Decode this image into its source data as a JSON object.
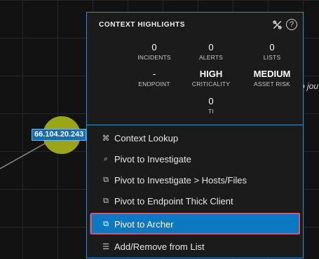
{
  "graph": {
    "node_label": "66.104.20.243",
    "edge_text": "o jou",
    "colors": {
      "node": "#9aa617",
      "label_bg": "#0f6fb5"
    }
  },
  "popup": {
    "title": "CONTEXT HIGHLIGHTS",
    "help_glyph": "?",
    "icons": [
      "tools-icon",
      "help-icon"
    ],
    "stats": [
      {
        "value": "0",
        "label": "INCIDENTS"
      },
      {
        "value": "0",
        "label": "ALERTS"
      },
      {
        "value": "0",
        "label": "LISTS"
      },
      {
        "value": "-",
        "label": "ENDPOINT"
      },
      {
        "value": "HIGH",
        "label": "CRITICALITY"
      },
      {
        "value": "MEDIUM",
        "label": "ASSET RISK"
      },
      {
        "value": "0",
        "label": "TI"
      }
    ],
    "menu": [
      {
        "label": "Context Lookup",
        "icon": "lookup-icon",
        "glyph": "⌘"
      },
      {
        "label": "Pivot to Investigate",
        "icon": "search-icon",
        "glyph": "⌕"
      },
      {
        "label": "Pivot to Investigate > Hosts/Files",
        "icon": "external-link-icon",
        "glyph": "⧉"
      },
      {
        "label": "Pivot to Endpoint Thick Client",
        "icon": "external-link-icon",
        "glyph": "⧉"
      },
      {
        "label": "Pivot to Archer",
        "icon": "external-link-icon",
        "glyph": "⧉",
        "active": true
      },
      {
        "label": "Add/Remove from List",
        "icon": "list-icon",
        "glyph": "☰"
      }
    ],
    "colors": {
      "accent": "#0a79c2",
      "border": "#2f8fcf",
      "highlight": "#e0525c"
    }
  }
}
